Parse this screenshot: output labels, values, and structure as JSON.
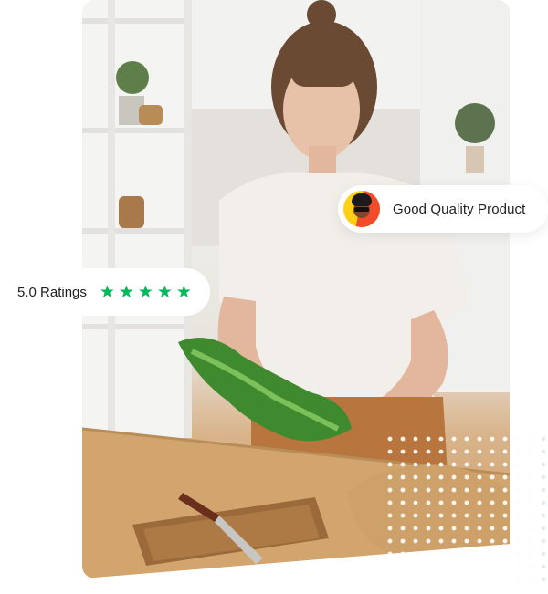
{
  "quality_badge": {
    "label": "Good Quality Product",
    "avatar_icon": "person-avatar"
  },
  "ratings_badge": {
    "label": "5.0 Ratings",
    "rating": 5,
    "star_icon": "star-icon",
    "star_color": "#00b85c"
  },
  "photo": {
    "subject_icon": "woman-with-lettuce-photo"
  }
}
